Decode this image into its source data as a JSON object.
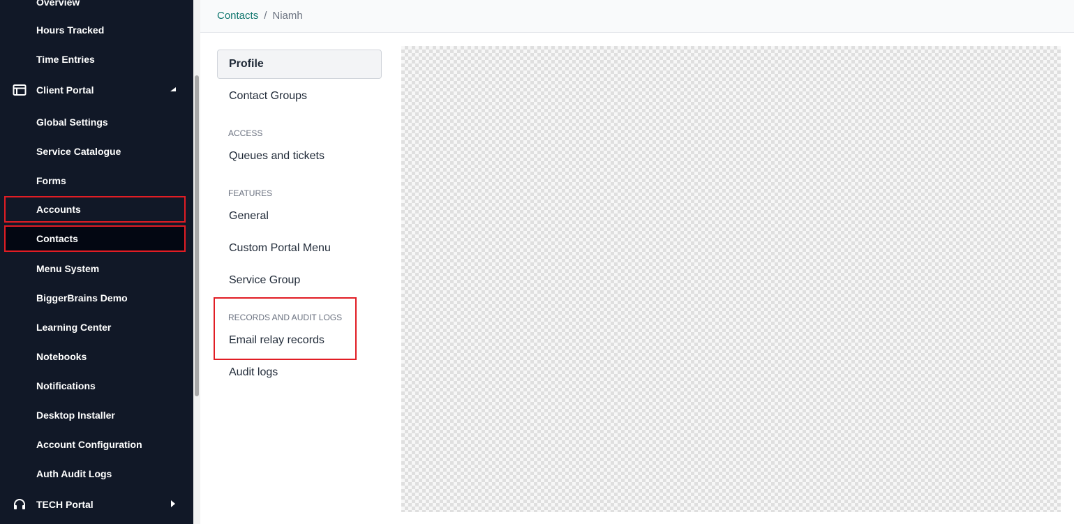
{
  "sidebar": {
    "items": [
      {
        "label": "Overview"
      },
      {
        "label": "Hours Tracked"
      },
      {
        "label": "Time Entries"
      }
    ],
    "client_portal": {
      "label": "Client Portal",
      "icon": "window-icon",
      "expanded": true,
      "items": [
        {
          "label": "Global Settings"
        },
        {
          "label": "Service Catalogue"
        },
        {
          "label": "Forms"
        },
        {
          "label": "Accounts"
        },
        {
          "label": "Contacts"
        },
        {
          "label": "Menu System"
        },
        {
          "label": "BiggerBrains Demo"
        },
        {
          "label": "Learning Center"
        },
        {
          "label": "Notebooks"
        },
        {
          "label": "Notifications"
        },
        {
          "label": "Desktop Installer"
        },
        {
          "label": "Account Configuration"
        },
        {
          "label": "Auth Audit Logs"
        }
      ]
    },
    "tech_portal": {
      "label": "TECH Portal",
      "icon": "headset-icon",
      "expanded": false
    }
  },
  "breadcrumb": {
    "parent": "Contacts",
    "separator": "/",
    "current": "Niamh"
  },
  "subnav": {
    "profile": "Profile",
    "contact_groups": "Contact Groups",
    "access_heading": "ACCESS",
    "queues_tickets": "Queues and tickets",
    "features_heading": "FEATURES",
    "general": "General",
    "custom_portal_menu": "Custom Portal Menu",
    "service_group": "Service Group",
    "records_heading": "RECORDS AND AUDIT LOGS",
    "email_relay_records": "Email relay records",
    "audit_logs": "Audit logs"
  },
  "colors": {
    "sidebar_bg": "#111827",
    "selected_bg": "#030712",
    "accent_link": "#0f766e",
    "annotation": "#e11d24"
  }
}
